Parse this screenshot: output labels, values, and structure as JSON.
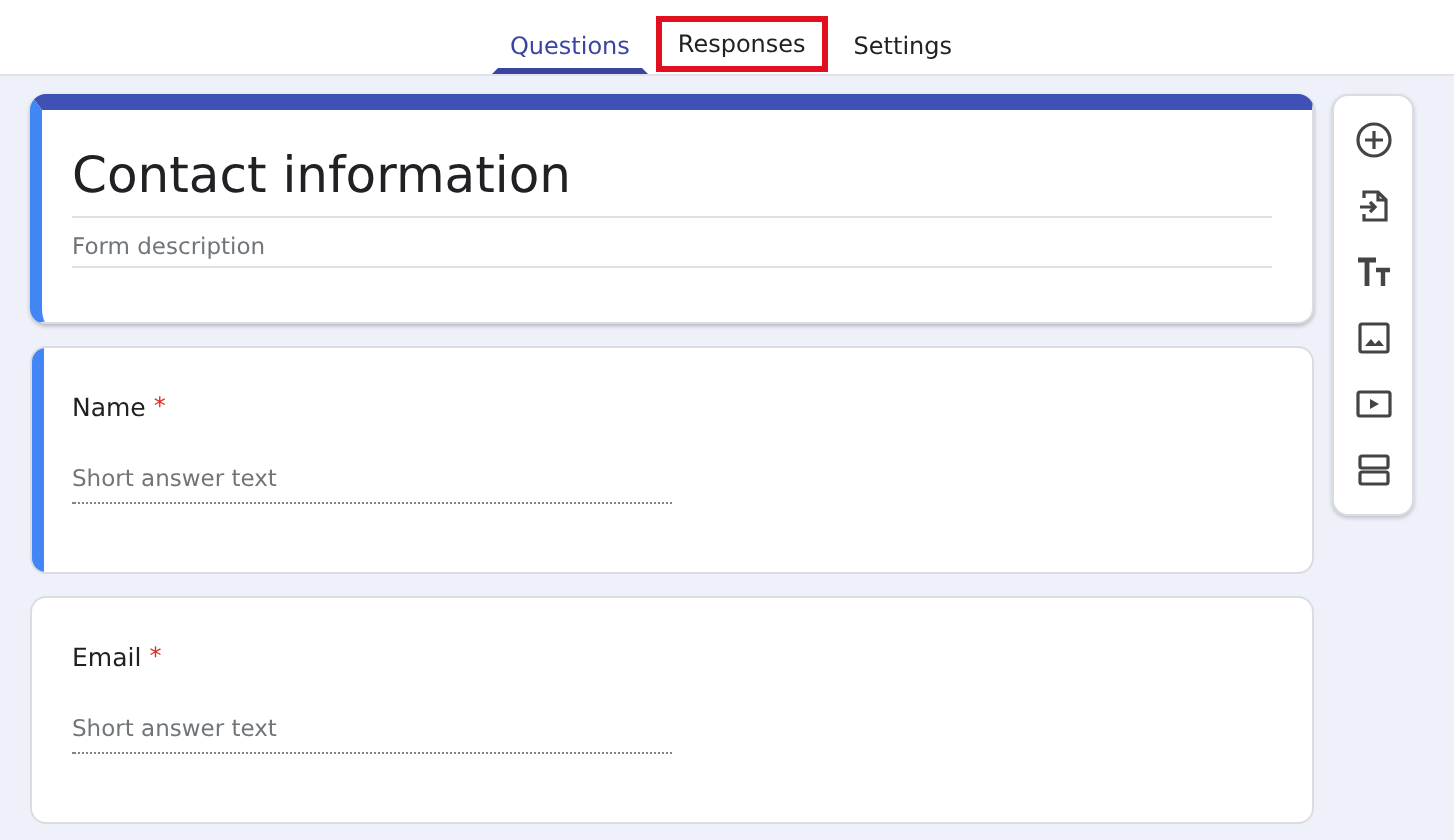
{
  "tabs": [
    {
      "label": "Questions",
      "selected": true,
      "highlighted": false
    },
    {
      "label": "Responses",
      "selected": false,
      "highlighted": true
    },
    {
      "label": "Settings",
      "selected": false,
      "highlighted": false
    }
  ],
  "form": {
    "title": "Contact information",
    "description_placeholder": "Form description"
  },
  "questions": [
    {
      "label": "Name",
      "required_mark": "*",
      "placeholder": "Short answer text",
      "focused": true
    },
    {
      "label": "Email",
      "required_mark": "*",
      "placeholder": "Short answer text",
      "focused": false
    }
  ],
  "toolbar": [
    {
      "kind": "add"
    },
    {
      "kind": "import"
    },
    {
      "kind": "title"
    },
    {
      "kind": "image"
    },
    {
      "kind": "video"
    },
    {
      "kind": "section"
    }
  ]
}
